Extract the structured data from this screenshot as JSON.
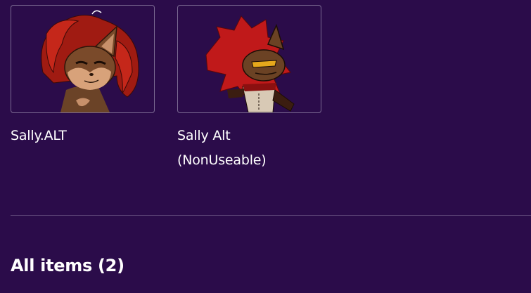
{
  "items": [
    {
      "title": "Sally.ALT",
      "thumbnail": "character-art-sally-alt"
    },
    {
      "title": "Sally Alt (NonUseable)",
      "thumbnail": "character-art-sally-alt-nonuseable"
    }
  ],
  "section": {
    "title": "All items (2)"
  },
  "colors": {
    "background": "#2b0c4a",
    "border": "#7b6a92",
    "divider": "#5d4577",
    "text": "#ffffff"
  }
}
